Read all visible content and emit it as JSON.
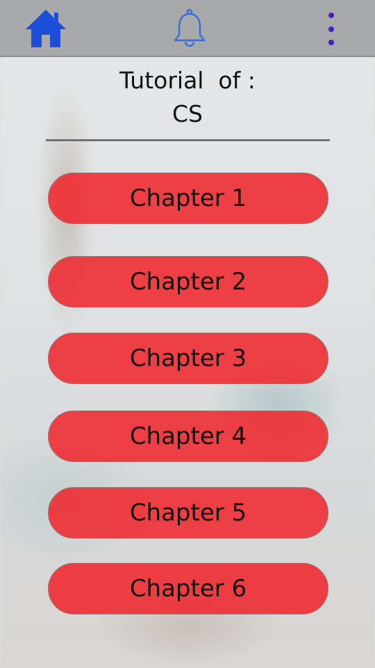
{
  "topbar": {
    "home_icon": "home-icon",
    "bell_icon": "bell-icon",
    "menu_icon": "more-vert-icon",
    "home_color": "#1d4ed8",
    "bell_color": "#3b6fd6",
    "menu_color": "#4a1fc1"
  },
  "header": {
    "title_line1": "Tutorial  of :",
    "title_line2": "CS"
  },
  "chapters": [
    {
      "label": "Chapter 1"
    },
    {
      "label": "Chapter 2"
    },
    {
      "label": "Chapter 3"
    },
    {
      "label": "Chapter 4"
    },
    {
      "label": "Chapter 5"
    },
    {
      "label": "Chapter 6"
    }
  ],
  "colors": {
    "chapter_button": "#ef282d",
    "topbar": "#a7a9aa"
  }
}
